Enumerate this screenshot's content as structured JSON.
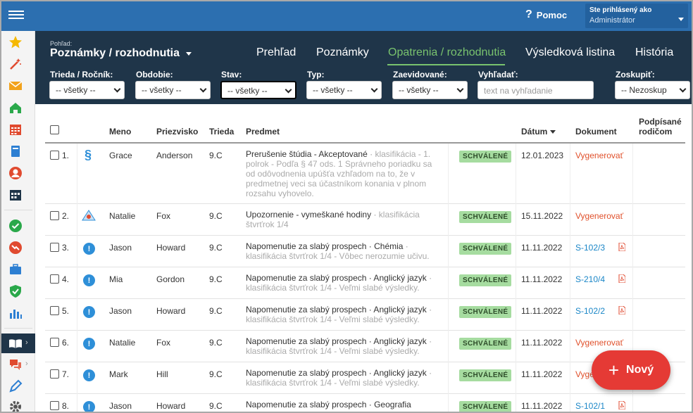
{
  "topbar": {
    "help_label": "Pomoc",
    "user_line1": "Ste prihlásený ako",
    "user_line2": "Administrátor"
  },
  "header": {
    "view_label": "Pohľad:",
    "view_title": "Poznámky / rozhodnutia",
    "tabs": [
      {
        "label": "Prehľad"
      },
      {
        "label": "Poznámky"
      },
      {
        "label": "Opatrenia / rozhodnutia"
      },
      {
        "label": "Výsledková listina"
      },
      {
        "label": "História"
      }
    ],
    "active_tab": "Opatrenia / rozhodnutia"
  },
  "filters": {
    "trieda": {
      "label": "Trieda / Ročník:",
      "value": "-- všetky --"
    },
    "obdobie": {
      "label": "Obdobie:",
      "value": "-- všetky --"
    },
    "stav": {
      "label": "Stav:",
      "value": "-- všetky --"
    },
    "typ": {
      "label": "Typ:",
      "value": "-- všetky --"
    },
    "zaevidovane": {
      "label": "Zaevidované:",
      "value": "-- všetky --"
    },
    "vyhladat": {
      "label": "Vyhľadať:",
      "placeholder": "text na vyhľadanie"
    },
    "zoskupit": {
      "label": "Zoskupiť:",
      "value": "-- Nezoskup"
    }
  },
  "table": {
    "headers": {
      "meno": "Meno",
      "priezvisko": "Priezvisko",
      "trieda": "Trieda",
      "predmet": "Predmet",
      "datum": "Dátum",
      "dokument": "Dokument",
      "podpisane1": "Podpísané",
      "podpisane2": "rodičom"
    },
    "rows": [
      {
        "num": "1.",
        "meno": "Grace",
        "priezvisko": "Anderson",
        "trieda": "9.C",
        "s_main": "Prerušenie štúdia - Akceptované",
        "s_sep": " · ",
        "s_det": "klasifikácia - 1. polrok - Podľa § 47 ods. 1 Správneho poriadku sa od odôvodnenia upúšťa vzhľadom na to, že v predmetnej veci sa účastníkom konania v plnom rozsahu vyhovelo.",
        "stav": "SCHVÁLENÉ",
        "datum": "12.01.2023",
        "doc": "Vygenerovať"
      },
      {
        "num": "2.",
        "meno": "Natalie",
        "priezvisko": "Fox",
        "trieda": "9.C",
        "s_main": "Upozornenie - vymeškané hodiny",
        "s_sep": " · ",
        "s_det": "klasifikácia štvrťrok 1/4",
        "stav": "SCHVÁLENÉ",
        "datum": "15.11.2022",
        "doc": "Vygenerovať"
      },
      {
        "num": "3.",
        "meno": "Jason",
        "priezvisko": "Howard",
        "trieda": "9.C",
        "s_main": "Napomenutie za slabý prospech · Chémia",
        "s_sep": " · ",
        "s_det": "klasifikácia štvrťrok 1/4 - Vôbec nerozumie učivu.",
        "stav": "SCHVÁLENÉ",
        "datum": "11.11.2022",
        "doc": "S-102/3"
      },
      {
        "num": "4.",
        "meno": "Mia",
        "priezvisko": "Gordon",
        "trieda": "9.C",
        "s_main": "Napomenutie za slabý prospech · Anglický jazyk",
        "s_sep": " · ",
        "s_det": "klasifikácia štvrťrok 1/4 - Veľmi slabé výsledky.",
        "stav": "SCHVÁLENÉ",
        "datum": "11.11.2022",
        "doc": "S-210/4"
      },
      {
        "num": "5.",
        "meno": "Jason",
        "priezvisko": "Howard",
        "trieda": "9.C",
        "s_main": "Napomenutie za slabý prospech · Anglický jazyk",
        "s_sep": " · ",
        "s_det": "klasifikácia štvrťrok 1/4 - Veľmi slabé výsledky.",
        "stav": "SCHVÁLENÉ",
        "datum": "11.11.2022",
        "doc": "S-102/2"
      },
      {
        "num": "6.",
        "meno": "Natalie",
        "priezvisko": "Fox",
        "trieda": "9.C",
        "s_main": "Napomenutie za slabý prospech · Anglický jazyk",
        "s_sep": " · ",
        "s_det": "klasifikácia štvrťrok 1/4 - Veľmi slabé výsledky.",
        "stav": "SCHVÁLENÉ",
        "datum": "11.11.2022",
        "doc": "Vygenerovať"
      },
      {
        "num": "7.",
        "meno": "Mark",
        "priezvisko": "Hill",
        "trieda": "9.C",
        "s_main": "Napomenutie za slabý prospech · Anglický jazyk",
        "s_sep": " · ",
        "s_det": "klasifikácia štvrťrok 1/4 - Veľmi slabé výsledky.",
        "stav": "SCHVÁLENÉ",
        "datum": "11.11.2022",
        "doc": "Vyge"
      },
      {
        "num": "8.",
        "meno": "Jason",
        "priezvisko": "Howard",
        "trieda": "9.C",
        "s_main": "Napomenutie za slabý prospech · Geografia",
        "s_sep": "",
        "s_det": "",
        "stav": "SCHVÁLENÉ",
        "datum": "11.11.2022",
        "doc": "S-102/1"
      }
    ]
  },
  "fab": {
    "label": "Nový"
  },
  "colors": {
    "topbar": "#2c6fb0",
    "header": "#1f3549",
    "accent": "#79c36e",
    "fab": "#e53a35",
    "link": "#1a86c7",
    "generate": "#e0502b"
  }
}
